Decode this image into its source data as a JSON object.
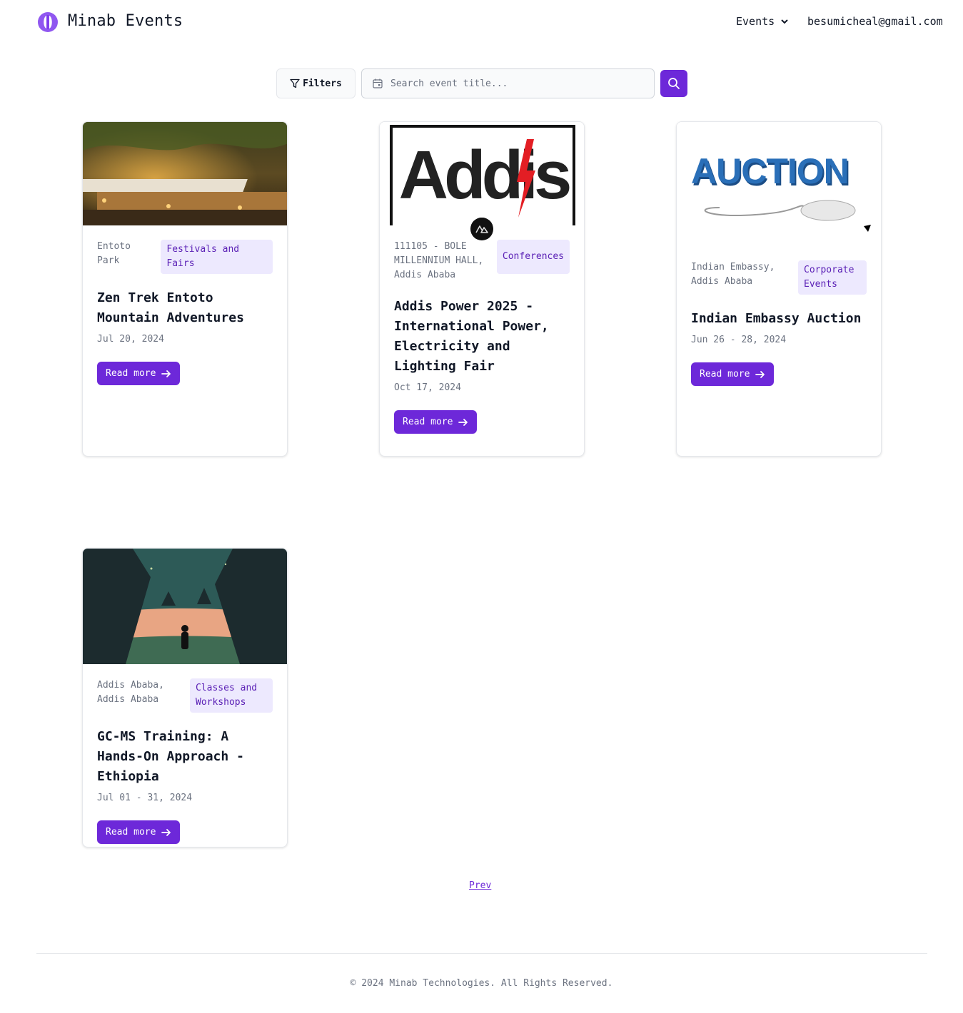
{
  "header": {
    "brand": "Minab Events",
    "nav_events": "Events",
    "user_email": "besumicheal@gmail.com"
  },
  "search": {
    "filters_label": "Filters",
    "placeholder": "Search event title..."
  },
  "events": [
    {
      "location": "Entoto Park",
      "category": "Festivals and Fairs",
      "title": "Zen Trek Entoto Mountain Adventures",
      "date": "Jul 20, 2024",
      "read_more": "Read more"
    },
    {
      "location": "111105 - BOLE MILLENNIUM HALL, Addis Ababa",
      "category": "Conferences",
      "title": "Addis Power 2025 - International Power, Electricity and Lighting Fair",
      "date": "Oct 17, 2024",
      "read_more": "Read more",
      "image_text": "Addis"
    },
    {
      "location": "Indian Embassy, Addis Ababa",
      "category": "Corporate Events",
      "title": "Indian Embassy Auction",
      "date": "Jun 26 - 28, 2024",
      "read_more": "Read more",
      "image_text": "AUCTION"
    },
    {
      "location": "Addis Ababa, Addis Ababa",
      "category": "Classes and Workshops",
      "title": "GC-MS Training: A Hands-On Approach - Ethiopia",
      "date": "Jul 01 - 31, 2024",
      "read_more": "Read more"
    }
  ],
  "pagination": {
    "prev": "Prev"
  },
  "footer": {
    "copyright": "© 2024 Minab Technologies. All Rights Reserved."
  },
  "colors": {
    "accent": "#6d28d9",
    "badge_bg": "#ede9fe",
    "badge_text": "#5b21b6"
  }
}
